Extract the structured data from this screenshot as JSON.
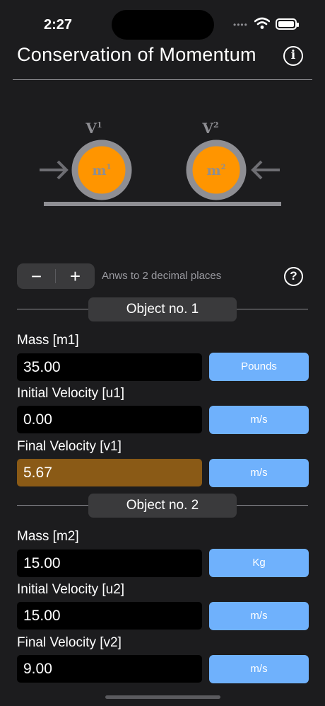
{
  "status_bar": {
    "time": "2:27"
  },
  "header": {
    "title": "Conservation of Momentum",
    "info_icon": "info-circle-icon"
  },
  "diagram": {
    "v1_label": "V",
    "v1_sup": "1",
    "v2_label": "V",
    "v2_sup": "2",
    "m1_label": "m",
    "m1_sup": "1",
    "m2_label": "m",
    "m2_sup": "2",
    "ball_color": "#ff9500",
    "ring_color": "#8e8e93"
  },
  "controls": {
    "minus": "−",
    "plus": "+",
    "decimal_text": "Anws to 2 decimal places",
    "help": "?"
  },
  "object1": {
    "heading": "Object no. 1",
    "mass_label": "Mass [m1]",
    "mass_value": "35.00",
    "mass_unit": "Pounds",
    "u_label": "Initial Velocity [u1]",
    "u_value": "0.00",
    "u_unit": "m/s",
    "v_label": "Final Velocity [v1]",
    "v_value": "5.67",
    "v_unit": "m/s"
  },
  "object2": {
    "heading": "Object no. 2",
    "mass_label": "Mass [m2]",
    "mass_value": "15.00",
    "mass_unit": "Kg",
    "u_label": "Initial Velocity [u2]",
    "u_value": "15.00",
    "u_unit": "m/s",
    "v_label": "Final Velocity [v2]",
    "v_value": "9.00",
    "v_unit": "m/s"
  },
  "colors": {
    "unit_button": "#6fb1fc",
    "result_field": "#8a5a16",
    "background": "#1c1c1e"
  }
}
